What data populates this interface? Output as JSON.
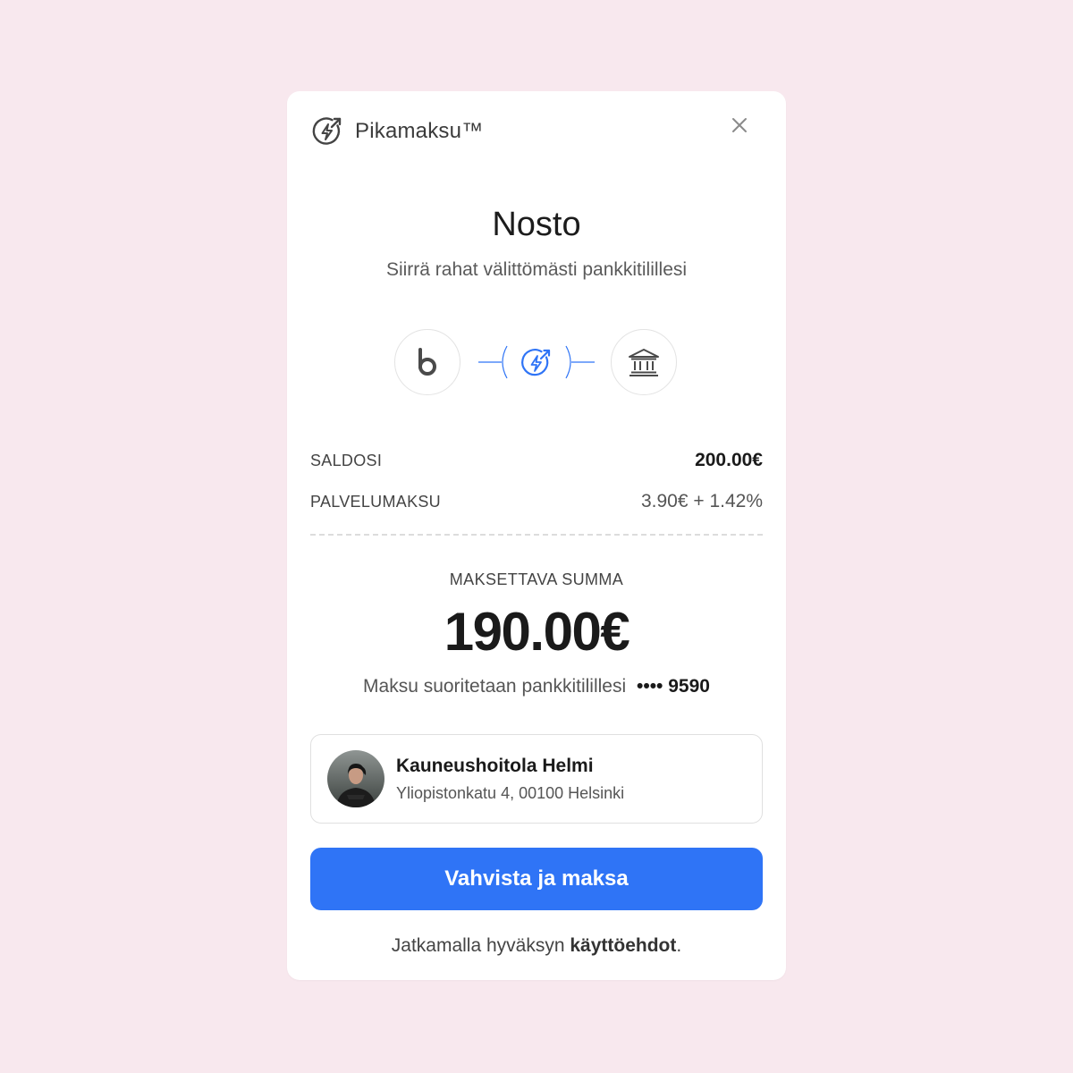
{
  "brand": {
    "name": "Pikamaksu™",
    "icon": "lightning-circle-icon"
  },
  "close": {
    "icon": "close-icon"
  },
  "title": "Nosto",
  "subtitle": "Siirrä rahat välittömästi pankkitilillesi",
  "flow": {
    "from_label": "b",
    "from_icon": "b-logo-icon",
    "via_icon": "lightning-circle-icon",
    "to_icon": "bank-icon"
  },
  "summary": {
    "balance_label": "SALDOSI",
    "balance_value": "200.00€",
    "fee_label": "PALVELUMAKSU",
    "fee_value": "3.90€ + 1.42%"
  },
  "payment": {
    "amount_label": "MAKSETTAVA SUMMA",
    "amount": "190.00€",
    "destination_text": "Maksu suoritetaan pankkitilillesi",
    "account_masked": "•••• 9590"
  },
  "merchant": {
    "name": "Kauneushoitola Helmi",
    "address": "Yliopistonkatu 4, 00100 Helsinki"
  },
  "actions": {
    "confirm_label": "Vahvista ja maksa"
  },
  "terms": {
    "prefix": "Jatkamalla hyväksyn ",
    "link_label": "käyttöehdot",
    "suffix": "."
  },
  "colors": {
    "background": "#F8E8EE",
    "card": "#FFFFFF",
    "primary": "#2F74F6",
    "text": "#1A1A1A",
    "muted": "#555555"
  }
}
